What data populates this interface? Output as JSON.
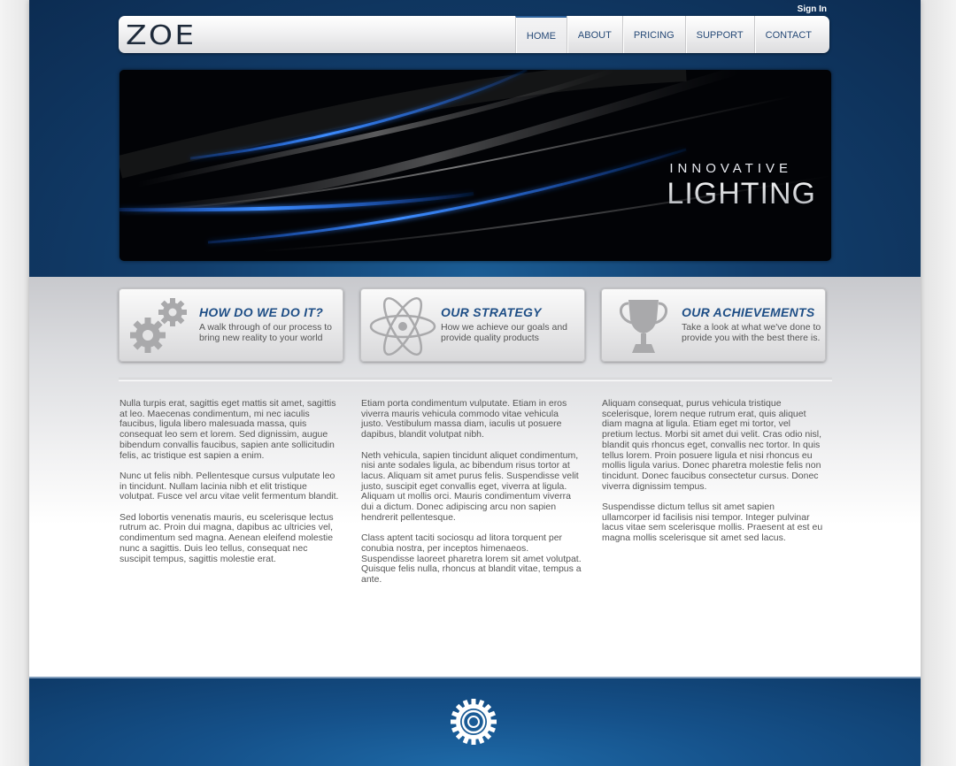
{
  "header": {
    "signin_label": "Sign In",
    "logo_text": "ZOE",
    "nav": [
      "HOME",
      "ABOUT",
      "PRICING",
      "SUPPORT",
      "CONTACT"
    ],
    "active_nav": "HOME"
  },
  "hero": {
    "small_text": "INNOVATIVE",
    "big_text": "LIGHTING"
  },
  "features": [
    {
      "icon": "gears-icon",
      "title": "HOW DO WE DO IT?",
      "desc": "A walk through of our process to bring new reality to your world"
    },
    {
      "icon": "atom-icon",
      "title": "OUR STRATEGY",
      "desc": "How we achieve our goals and provide quality products"
    },
    {
      "icon": "trophy-icon",
      "title": "OUR ACHIEVEMENTS",
      "desc": "Take a look at what we've done to provide you with the best there is."
    }
  ],
  "columns": [
    [
      "Nulla turpis erat, sagittis eget mattis sit amet, sagittis at leo. Maecenas condimentum, mi nec iaculis faucibus, ligula libero malesuada massa, quis consequat leo sem et lorem. Sed dignissim, augue bibendum convallis faucibus, sapien ante sollicitudin felis, ac tristique est sapien a enim.",
      "Nunc ut felis nibh. Pellentesque cursus vulputate leo in tincidunt. Nullam lacinia nibh et elit tristique volutpat. Fusce vel arcu vitae velit fermentum blandit.",
      "Sed lobortis venenatis mauris, eu scelerisque lectus rutrum ac. Proin dui magna, dapibus ac ultricies vel, condimentum sed magna. Aenean eleifend molestie nunc a sagittis. Duis leo tellus, consequat nec suscipit tempus, sagittis molestie erat."
    ],
    [
      "Etiam porta condimentum vulputate. Etiam in eros viverra mauris vehicula commodo vitae vehicula justo. Vestibulum massa diam, iaculis ut posuere dapibus, blandit volutpat nibh.",
      "Neth vehicula, sapien tincidunt aliquet condimentum, nisi ante sodales ligula, ac bibendum risus tortor at lacus. Aliquam sit amet purus felis. Suspendisse velit justo, suscipit eget convallis eget, viverra at ligula. Aliquam ut mollis orci. Mauris condimentum viverra dui a dictum. Donec adipiscing arcu non sapien hendrerit pellentesque.",
      "Class aptent taciti sociosqu ad litora torquent per conubia nostra, per inceptos himenaeos. Suspendisse laoreet pharetra lorem sit amet volutpat. Quisque felis nulla, rhoncus at blandit vitae, tempus a ante."
    ],
    [
      "Aliquam consequat, purus vehicula tristique scelerisque, lorem neque rutrum erat, quis aliquet diam magna at ligula. Etiam eget mi tortor, vel pretium lectus. Morbi sit amet dui velit. Cras odio nisl, blandit quis rhoncus eget, convallis nec tortor. In quis tellus lorem. Proin posuere ligula et nisi rhoncus eu mollis ligula varius. Donec pharetra molestie felis non tincidunt. Donec faucibus consectetur cursus. Donec viverra dignissim tempus.",
      "Suspendisse dictum tellus sit amet sapien ullamcorper id facilisis nisi tempor. Integer pulvinar lacus vitae sem scelerisque mollis. Praesent at est eu magna mollis scelerisque sit amet sed lacus."
    ]
  ],
  "footer": {
    "icon": "gear-logo-icon"
  },
  "colors": {
    "accent": "#1e4e86",
    "band": "#123e6c",
    "text": "#555555"
  }
}
